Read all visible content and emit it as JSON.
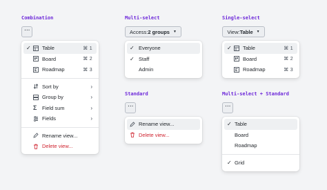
{
  "sections": {
    "combination": "Combination",
    "multi_select": "Multi-select",
    "single_select": "Single-select",
    "standard": "Standard",
    "multi_standard": "Multi-select + Standard"
  },
  "triggers": {
    "dots": "···",
    "multi_prefix": "Access: ",
    "multi_value": "2 groups",
    "single_prefix": "View: ",
    "single_value": "Table"
  },
  "combination_menu": {
    "views": [
      {
        "label": "Table",
        "shortcut": "⌘1",
        "icon": "table-icon",
        "checked": true
      },
      {
        "label": "Board",
        "shortcut": "⌘2",
        "icon": "board-icon",
        "checked": false
      },
      {
        "label": "Roadmap",
        "shortcut": "⌘3",
        "icon": "roadmap-icon",
        "checked": false
      }
    ],
    "submenus": [
      {
        "label": "Sort by",
        "icon": "sort-icon"
      },
      {
        "label": "Group by",
        "icon": "group-icon"
      },
      {
        "label": "Field sum",
        "icon": "sum-icon"
      },
      {
        "label": "Fields",
        "icon": "fields-icon"
      }
    ],
    "rename": "Rename view...",
    "delete": "Delete view..."
  },
  "multi_menu": {
    "items": [
      {
        "label": "Everyone",
        "checked": true
      },
      {
        "label": "Staff",
        "checked": true
      },
      {
        "label": "Admin",
        "checked": false
      }
    ]
  },
  "single_menu": {
    "items": [
      {
        "label": "Table",
        "shortcut": "⌘1",
        "checked": true
      },
      {
        "label": "Board",
        "shortcut": "⌘2",
        "checked": false
      },
      {
        "label": "Roadmap",
        "shortcut": "⌘3",
        "checked": false
      }
    ]
  },
  "standard_menu": {
    "rename": "Rename view...",
    "delete": "Delete view..."
  },
  "multi_standard_menu": {
    "items": [
      {
        "label": "Table",
        "checked": true
      },
      {
        "label": "Board",
        "checked": false
      },
      {
        "label": "Roadmap",
        "checked": false
      }
    ],
    "grid": {
      "label": "Grid",
      "checked": true
    }
  },
  "colors": {
    "section_title": "#6d28d9",
    "danger": "#cf222e",
    "highlight": "#eef0f2",
    "background": "#f3f4f6"
  }
}
